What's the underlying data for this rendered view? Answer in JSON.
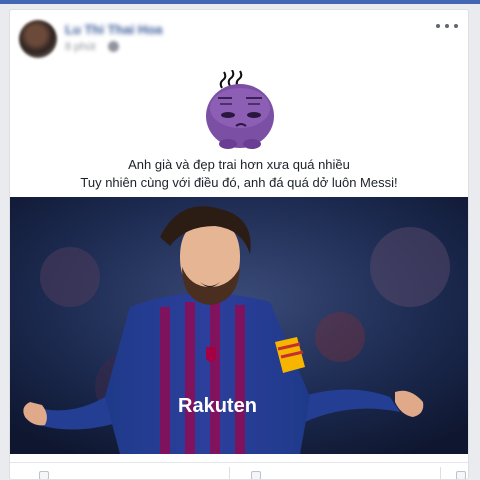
{
  "post": {
    "author_name": "Lu Thi Thai Hoa",
    "timestamp": "8 phút",
    "privacy_icon": "globe-icon",
    "caption_line1": "Anh già và đẹp trai hơn xưa quá nhiều",
    "caption_line2": "Tuy nhiên cùng với điều đó, anh đá quá dở luôn Messi!",
    "sticker_icon": "purple-blob-sticker",
    "photo_icon": "messi-photo",
    "jersey_text": "Rakuten",
    "options_icon": "more-options-icon"
  },
  "colors": {
    "background": "#e9ebee",
    "link": "#385898",
    "accent": "#4267b2",
    "sticker_purple": "#7b4fa3",
    "jersey_blue": "#1f3a8a",
    "jersey_red": "#a50044"
  },
  "actions": {
    "items": [
      "like-icon",
      "comment-icon",
      "share-icon"
    ]
  }
}
